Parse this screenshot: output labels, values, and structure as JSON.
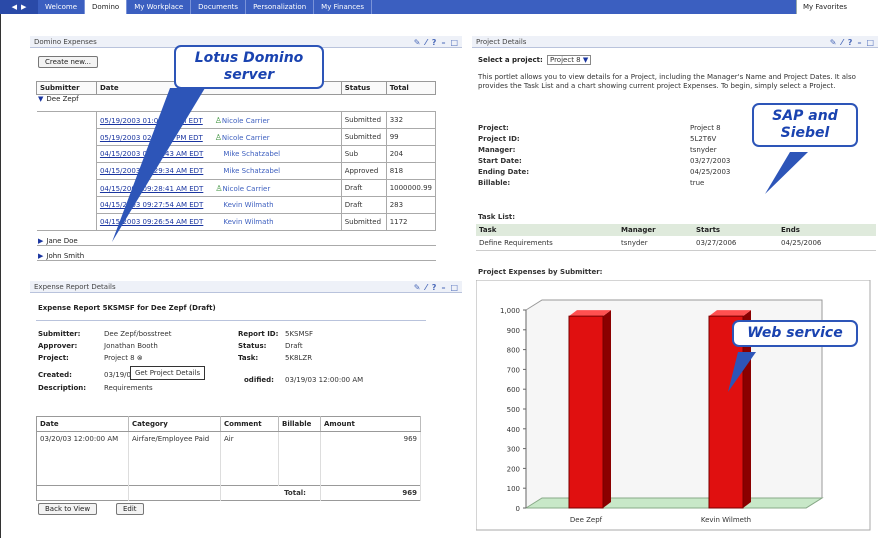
{
  "tabs": {
    "items": [
      "Welcome",
      "Domino",
      "My Workplace",
      "Documents",
      "Personalization",
      "My Finances"
    ],
    "favorites": "My Favorites"
  },
  "domino_expenses": {
    "title": "Domino Expenses",
    "create_button": "Create new...",
    "headers": [
      "Submitter",
      "Date",
      "Status",
      "Total"
    ],
    "group_open": "Dee Zepf",
    "rows": [
      {
        "date": "05/19/2003 01:03:33 PM EDT",
        "person": "Nicole Carrier",
        "icon": true,
        "status": "Submitted",
        "total": "332"
      },
      {
        "date": "05/19/2003 02:57:21 PM EDT",
        "person": "Nicole Carrier",
        "icon": true,
        "status": "Submitted",
        "total": "99"
      },
      {
        "date": "04/15/2003 09:31:43 AM EDT",
        "person": "Mike Schatzabel",
        "icon": false,
        "status": "Sub",
        "total": "204"
      },
      {
        "date": "04/15/2003 09:29:34 AM EDT",
        "person": "Mike Schatzabel",
        "icon": false,
        "status": "Approved",
        "total": "818"
      },
      {
        "date": "04/15/2003 09:28:41 AM EDT",
        "person": "Nicole Carrier",
        "icon": true,
        "status": "Draft",
        "total": "1000000.99"
      },
      {
        "date": "04/15/2003 09:27:54 AM EDT",
        "person": "Kevin Wilmath",
        "icon": false,
        "status": "Draft",
        "total": "283"
      },
      {
        "date": "04/15/2003 09:26:54 AM EDT",
        "person": "Kevin Wilmath",
        "icon": false,
        "status": "Submitted",
        "total": "1172"
      }
    ],
    "group_closed": [
      "Jane Doe",
      "John Smith"
    ]
  },
  "report": {
    "title": "Expense Report Details",
    "heading": "Expense Report 5KSMSF for Dee Zepf (Draft)",
    "submitter_label": "Submitter:",
    "submitter": "Dee Zepf/bosstreet",
    "approver_label": "Approver:",
    "approver": "Jonathan Booth",
    "project_label": "Project:",
    "project": "Project 8",
    "created_label": "Created:",
    "created": "03/19/03 1",
    "description_label": "Description:",
    "description": "Requirements",
    "report_id_label": "Report ID:",
    "report_id": "5KSMSF",
    "status_label": "Status:",
    "status": "Draft",
    "task_label": "Task:",
    "task": "5K8LZR",
    "modified_label": "odified:",
    "modified": "03/19/03 12:00:00 AM",
    "tooltip": "Get Project Details",
    "headers": [
      "Date",
      "Category",
      "Comment",
      "Billable",
      "Amount"
    ],
    "item": {
      "date": "03/20/03 12:00:00 AM",
      "category": "Airfare/Employee Paid",
      "comment": "Air",
      "billable": "",
      "amount": "969"
    },
    "total_label": "Total:",
    "total": "969",
    "back_button": "Back to View",
    "edit_button": "Edit"
  },
  "project": {
    "title": "Project Details",
    "select_label": "Select a project:",
    "selected": "Project 8",
    "description": "This portlet allows you to view details for a Project, including the Manager's Name and Project Dates. It also provides the Task List and a chart showing current project Expenses. To begin, simply select a Project.",
    "fields": [
      {
        "label": "Project:",
        "value": "Project 8"
      },
      {
        "label": "Project ID:",
        "value": "5L2T6V"
      },
      {
        "label": "Manager:",
        "value": "tsnyder"
      },
      {
        "label": "Start Date:",
        "value": "03/27/2003"
      },
      {
        "label": "Ending Date:",
        "value": "04/25/2003"
      },
      {
        "label": "Billable:",
        "value": "true"
      }
    ],
    "task_list_label": "Task List:",
    "task_headers": [
      "Task",
      "Manager",
      "Starts",
      "Ends"
    ],
    "task_rows": [
      [
        "Define Requirements",
        "tsnyder",
        "03/27/2006",
        "04/25/2006"
      ]
    ],
    "chart_title": "Project Expenses by Submitter:"
  },
  "chart_data": {
    "type": "bar",
    "title": "Project Expenses by Submitter:",
    "categories": [
      "Dee Zepf",
      "Kevin Wilmeth"
    ],
    "values": [
      969,
      969
    ],
    "ylim": [
      0,
      1000
    ],
    "yticks": [
      "0",
      "100",
      "200",
      "300",
      "400",
      "500",
      "600",
      "700",
      "800",
      "900",
      "1,000"
    ],
    "bar_color": "#e01010"
  },
  "callouts": {
    "domino": "Lotus Domino server",
    "sap": "SAP and Siebel",
    "web": "Web service"
  },
  "colors": {
    "accent": "#2d55b8",
    "tabbar": "#3b5fc0"
  }
}
